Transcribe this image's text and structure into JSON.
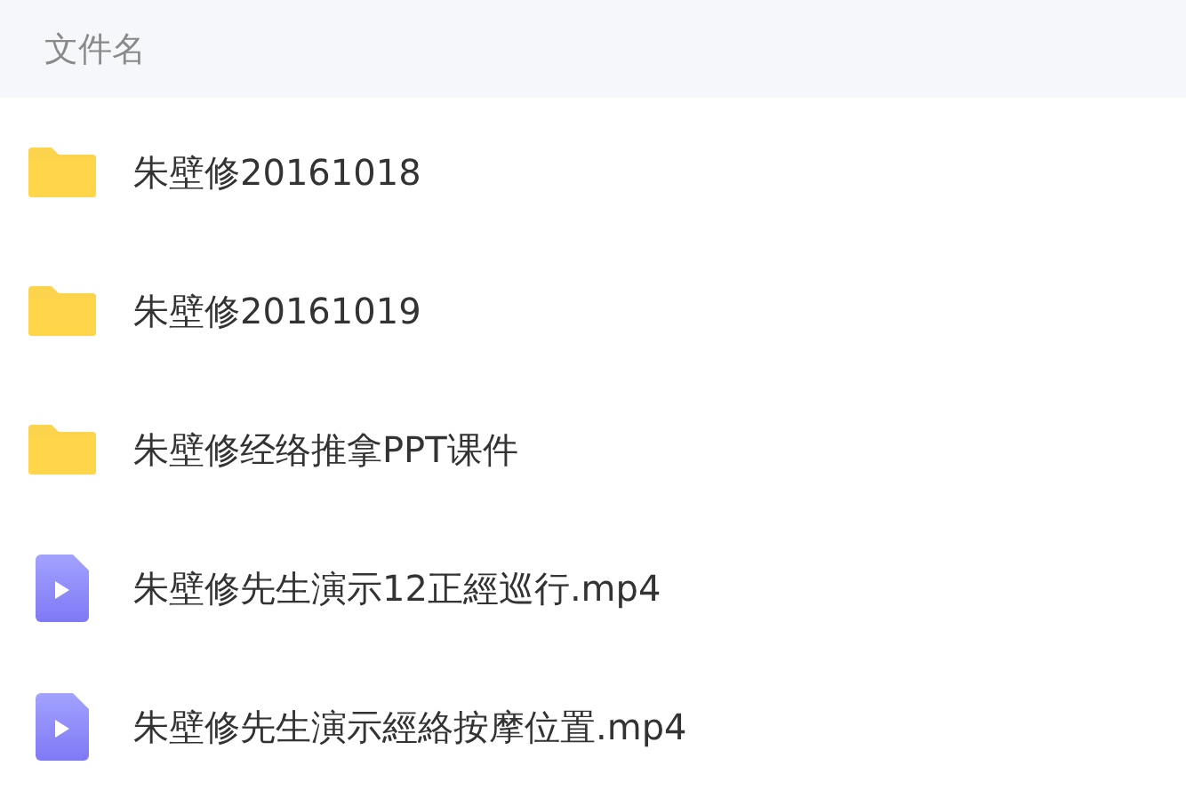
{
  "header": {
    "label": "文件名"
  },
  "files": [
    {
      "kind": "folder",
      "name": "朱壁修20161018"
    },
    {
      "kind": "folder",
      "name": "朱壁修20161019"
    },
    {
      "kind": "folder",
      "name": "朱壁修经络推拿PPT课件"
    },
    {
      "kind": "video",
      "name": "朱壁修先生演示12正經巡行.mp4"
    },
    {
      "kind": "video",
      "name": "朱壁修先生演示經絡按摩位置.mp4"
    }
  ]
}
